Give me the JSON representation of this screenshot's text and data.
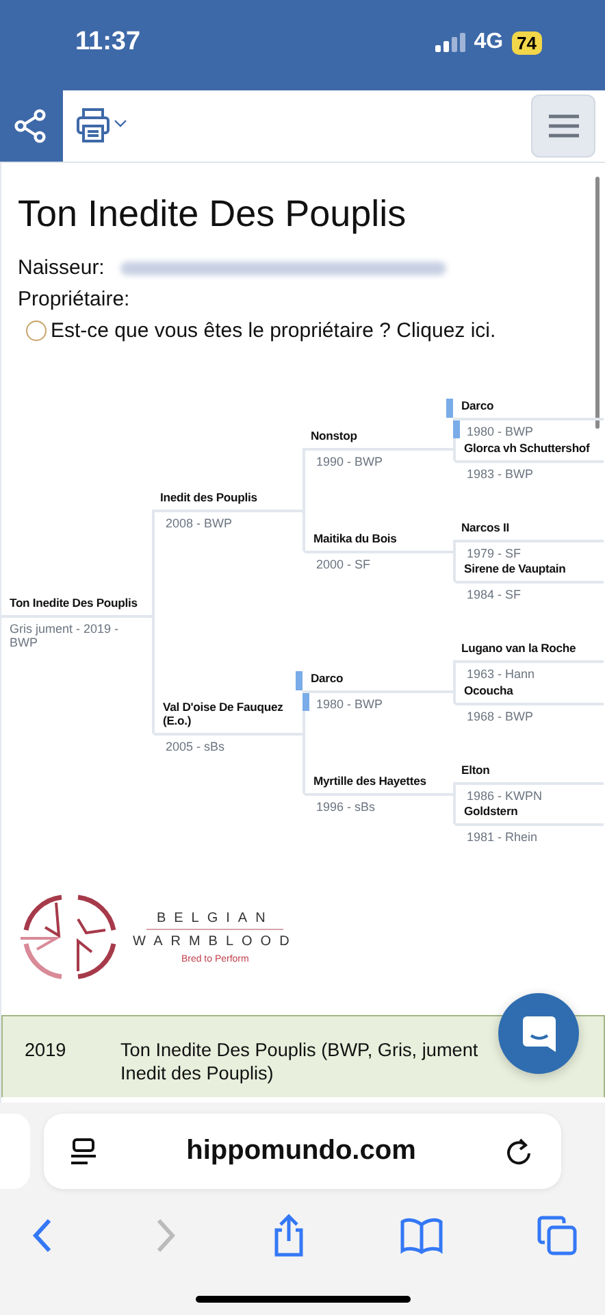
{
  "status_bar": {
    "time": "11:37",
    "network": "4G",
    "battery": "74"
  },
  "title": "Ton Inedite Des Pouplis",
  "breeder": {
    "label": "Naisseur:"
  },
  "owner": {
    "label": "Propriétaire:",
    "claim_link": "Est-ce que vous êtes le propriétaire ? Cliquez ici.",
    "selected": false
  },
  "pedigree": {
    "name": "Ton Inedite Des Pouplis",
    "info": "Gris jument - 2019 - BWP",
    "highlighted": false,
    "children": [
      {
        "name": "Inedit des Pouplis",
        "info": "2008 - BWP",
        "highlighted": false,
        "children": [
          {
            "name": "Nonstop",
            "info": "1990 - BWP",
            "highlighted": false,
            "children": [
              {
                "name": "Darco",
                "info": "1980 - BWP",
                "highlighted": true
              },
              {
                "name": "Glorca vh Schuttershof",
                "info": "1983 - BWP",
                "highlighted": false
              }
            ]
          },
          {
            "name": "Maitika du Bois",
            "info": "2000 - SF",
            "highlighted": false,
            "children": [
              {
                "name": "Narcos II",
                "info": "1979 - SF",
                "highlighted": false
              },
              {
                "name": "Sirene de Vauptain",
                "info": "1984 - SF",
                "highlighted": false
              }
            ]
          }
        ]
      },
      {
        "name": "Val D'oise De Fauquez (E.o.)",
        "info": "2005 - sBs",
        "highlighted": false,
        "children": [
          {
            "name": "Darco",
            "info": "1980 - BWP",
            "highlighted": true,
            "children": [
              {
                "name": "Lugano van la Roche",
                "info": "1963 - Hann",
                "highlighted": false
              },
              {
                "name": "Ocoucha",
                "info": "1968 - BWP",
                "highlighted": false
              }
            ]
          },
          {
            "name": "Myrtille des Hayettes",
            "info": "1996 - sBs",
            "highlighted": false,
            "children": [
              {
                "name": "Elton",
                "info": "1986 - KWPN",
                "highlighted": false
              },
              {
                "name": "Goldstern",
                "info": "1981 - Rhein",
                "highlighted": false
              }
            ]
          }
        ]
      }
    ]
  },
  "logo": {
    "line1": "BELGIAN",
    "line2": "WARMBLOOD",
    "tagline": "Bred to Perform"
  },
  "offspring": [
    {
      "year": "2019",
      "lines": [
        "Ton Inedite Des Pouplis (BWP, Gris, jument",
        "Inedit des Pouplis)"
      ]
    }
  ],
  "browser": {
    "url": "hippomundo.com"
  }
}
